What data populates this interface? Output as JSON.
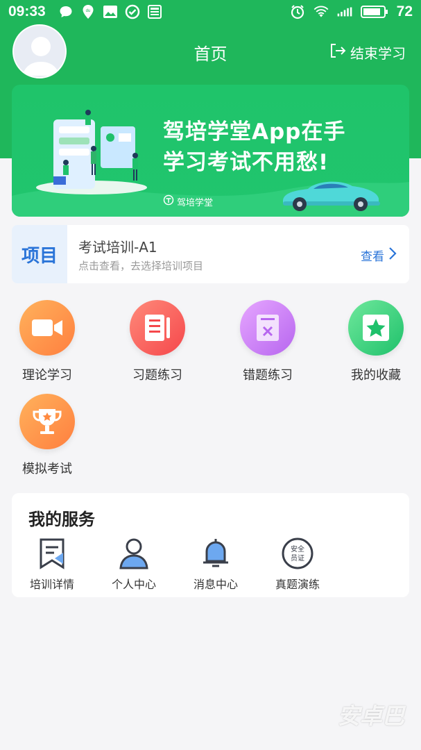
{
  "status_bar": {
    "time": "09:33",
    "battery": "72"
  },
  "header": {
    "title": "首页",
    "end_label": "结束学习"
  },
  "banner": {
    "headline1": "驾培学堂App在手",
    "headline2": "学习考试不用愁!",
    "brand": "驾培学堂"
  },
  "project": {
    "tag": "项目",
    "name": "考试培训-A1",
    "hint": "点击查看，去选择培训项目",
    "view_label": "查看"
  },
  "features": [
    {
      "label": "理论学习",
      "icon": "video-camera-icon",
      "color_from": "#ffb25c",
      "color_to": "#ff7f3f"
    },
    {
      "label": "习题练习",
      "icon": "document-list-icon",
      "color_from": "#ff8a7a",
      "color_to": "#f5474b"
    },
    {
      "label": "错题练习",
      "icon": "wrong-question-icon",
      "color_from": "#e6a6ff",
      "color_to": "#b766ef"
    },
    {
      "label": "我的收藏",
      "icon": "star-icon",
      "color_from": "#6fe89c",
      "color_to": "#1fc16b"
    },
    {
      "label": "模拟考试",
      "icon": "trophy-icon",
      "color_from": "#ffb25c",
      "color_to": "#ff7f3f"
    }
  ],
  "services": {
    "title": "我的服务",
    "items": [
      {
        "label": "培训详情",
        "icon": "bookmark-icon"
      },
      {
        "label": "个人中心",
        "icon": "person-icon"
      },
      {
        "label": "消息中心",
        "icon": "bell-icon"
      },
      {
        "label": "真题演练",
        "icon": "safety-badge-icon",
        "badge_text": "安全员证"
      }
    ]
  },
  "watermark": "安卓巴",
  "colors": {
    "primary_green": "#1fb75b",
    "link_blue": "#2a74d8"
  }
}
